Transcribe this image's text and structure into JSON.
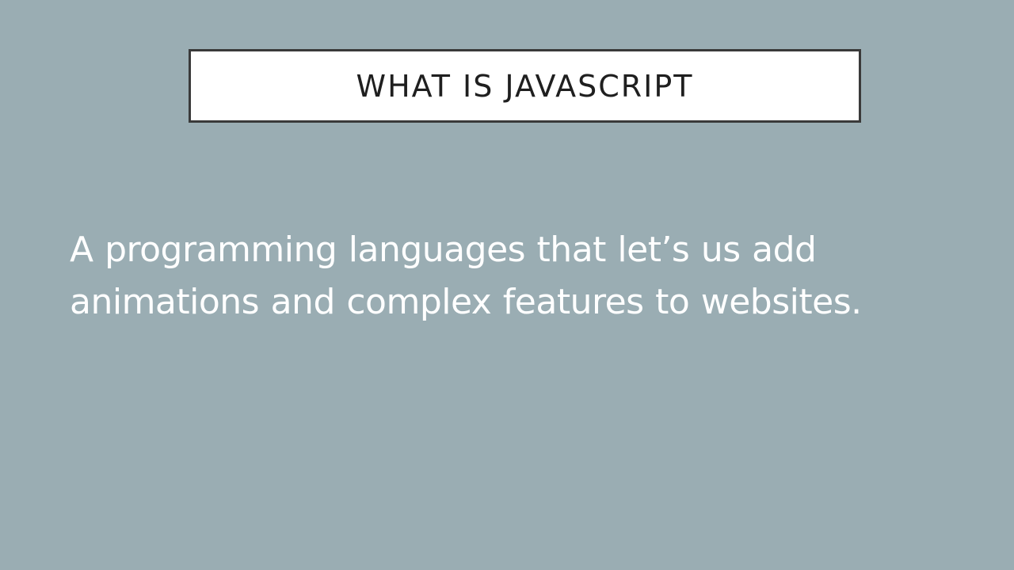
{
  "slide": {
    "title": "WHAT IS JAVASCRIPT",
    "body": "A programming languages that let’s us add animations and complex features to websites.",
    "colors": {
      "background": "#9aadb3",
      "title_box_fill": "#ffffff",
      "title_box_border": "#3a3a3a",
      "title_text": "#1f1f1f",
      "body_text": "#ffffff"
    }
  }
}
